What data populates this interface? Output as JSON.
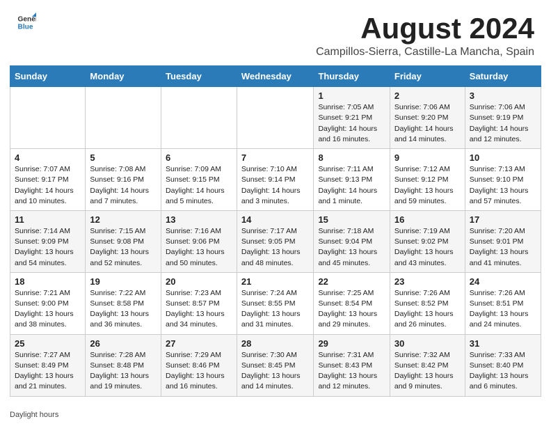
{
  "header": {
    "logo_general": "General",
    "logo_blue": "Blue",
    "title": "August 2024",
    "subtitle": "Campillos-Sierra, Castille-La Mancha, Spain"
  },
  "days_of_week": [
    "Sunday",
    "Monday",
    "Tuesday",
    "Wednesday",
    "Thursday",
    "Friday",
    "Saturday"
  ],
  "weeks": [
    [
      {
        "day": "",
        "info": ""
      },
      {
        "day": "",
        "info": ""
      },
      {
        "day": "",
        "info": ""
      },
      {
        "day": "",
        "info": ""
      },
      {
        "day": "1",
        "info": "Sunrise: 7:05 AM\nSunset: 9:21 PM\nDaylight: 14 hours and 16 minutes."
      },
      {
        "day": "2",
        "info": "Sunrise: 7:06 AM\nSunset: 9:20 PM\nDaylight: 14 hours and 14 minutes."
      },
      {
        "day": "3",
        "info": "Sunrise: 7:06 AM\nSunset: 9:19 PM\nDaylight: 14 hours and 12 minutes."
      }
    ],
    [
      {
        "day": "4",
        "info": "Sunrise: 7:07 AM\nSunset: 9:17 PM\nDaylight: 14 hours and 10 minutes."
      },
      {
        "day": "5",
        "info": "Sunrise: 7:08 AM\nSunset: 9:16 PM\nDaylight: 14 hours and 7 minutes."
      },
      {
        "day": "6",
        "info": "Sunrise: 7:09 AM\nSunset: 9:15 PM\nDaylight: 14 hours and 5 minutes."
      },
      {
        "day": "7",
        "info": "Sunrise: 7:10 AM\nSunset: 9:14 PM\nDaylight: 14 hours and 3 minutes."
      },
      {
        "day": "8",
        "info": "Sunrise: 7:11 AM\nSunset: 9:13 PM\nDaylight: 14 hours and 1 minute."
      },
      {
        "day": "9",
        "info": "Sunrise: 7:12 AM\nSunset: 9:12 PM\nDaylight: 13 hours and 59 minutes."
      },
      {
        "day": "10",
        "info": "Sunrise: 7:13 AM\nSunset: 9:10 PM\nDaylight: 13 hours and 57 minutes."
      }
    ],
    [
      {
        "day": "11",
        "info": "Sunrise: 7:14 AM\nSunset: 9:09 PM\nDaylight: 13 hours and 54 minutes."
      },
      {
        "day": "12",
        "info": "Sunrise: 7:15 AM\nSunset: 9:08 PM\nDaylight: 13 hours and 52 minutes."
      },
      {
        "day": "13",
        "info": "Sunrise: 7:16 AM\nSunset: 9:06 PM\nDaylight: 13 hours and 50 minutes."
      },
      {
        "day": "14",
        "info": "Sunrise: 7:17 AM\nSunset: 9:05 PM\nDaylight: 13 hours and 48 minutes."
      },
      {
        "day": "15",
        "info": "Sunrise: 7:18 AM\nSunset: 9:04 PM\nDaylight: 13 hours and 45 minutes."
      },
      {
        "day": "16",
        "info": "Sunrise: 7:19 AM\nSunset: 9:02 PM\nDaylight: 13 hours and 43 minutes."
      },
      {
        "day": "17",
        "info": "Sunrise: 7:20 AM\nSunset: 9:01 PM\nDaylight: 13 hours and 41 minutes."
      }
    ],
    [
      {
        "day": "18",
        "info": "Sunrise: 7:21 AM\nSunset: 9:00 PM\nDaylight: 13 hours and 38 minutes."
      },
      {
        "day": "19",
        "info": "Sunrise: 7:22 AM\nSunset: 8:58 PM\nDaylight: 13 hours and 36 minutes."
      },
      {
        "day": "20",
        "info": "Sunrise: 7:23 AM\nSunset: 8:57 PM\nDaylight: 13 hours and 34 minutes."
      },
      {
        "day": "21",
        "info": "Sunrise: 7:24 AM\nSunset: 8:55 PM\nDaylight: 13 hours and 31 minutes."
      },
      {
        "day": "22",
        "info": "Sunrise: 7:25 AM\nSunset: 8:54 PM\nDaylight: 13 hours and 29 minutes."
      },
      {
        "day": "23",
        "info": "Sunrise: 7:26 AM\nSunset: 8:52 PM\nDaylight: 13 hours and 26 minutes."
      },
      {
        "day": "24",
        "info": "Sunrise: 7:26 AM\nSunset: 8:51 PM\nDaylight: 13 hours and 24 minutes."
      }
    ],
    [
      {
        "day": "25",
        "info": "Sunrise: 7:27 AM\nSunset: 8:49 PM\nDaylight: 13 hours and 21 minutes."
      },
      {
        "day": "26",
        "info": "Sunrise: 7:28 AM\nSunset: 8:48 PM\nDaylight: 13 hours and 19 minutes."
      },
      {
        "day": "27",
        "info": "Sunrise: 7:29 AM\nSunset: 8:46 PM\nDaylight: 13 hours and 16 minutes."
      },
      {
        "day": "28",
        "info": "Sunrise: 7:30 AM\nSunset: 8:45 PM\nDaylight: 13 hours and 14 minutes."
      },
      {
        "day": "29",
        "info": "Sunrise: 7:31 AM\nSunset: 8:43 PM\nDaylight: 13 hours and 12 minutes."
      },
      {
        "day": "30",
        "info": "Sunrise: 7:32 AM\nSunset: 8:42 PM\nDaylight: 13 hours and 9 minutes."
      },
      {
        "day": "31",
        "info": "Sunrise: 7:33 AM\nSunset: 8:40 PM\nDaylight: 13 hours and 6 minutes."
      }
    ]
  ],
  "footer": {
    "daylight_label": "Daylight hours"
  }
}
